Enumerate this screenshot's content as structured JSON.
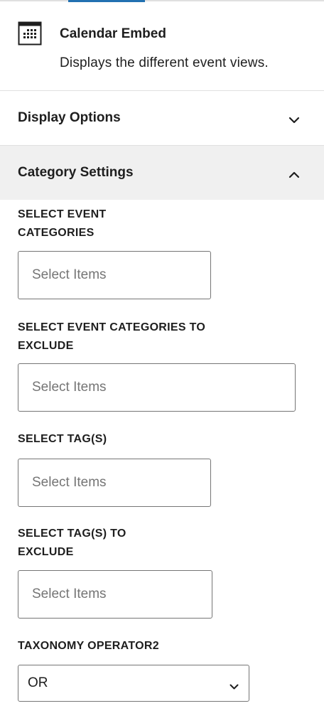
{
  "block": {
    "icon": "calendar-icon",
    "title": "Calendar Embed",
    "description": "Displays the different event views."
  },
  "panels": {
    "display_options": {
      "title": "Display Options",
      "state": "collapsed",
      "icon": "chevron-down-icon"
    },
    "category_settings": {
      "title": "Category Settings",
      "state": "expanded",
      "icon": "chevron-up-icon"
    }
  },
  "fields": {
    "event_categories": {
      "label_line1": "SELECT EVENT",
      "label_line2": "CATEGORIES",
      "placeholder": "Select Items",
      "value": ""
    },
    "exclude_categories": {
      "label_line1": "SELECT EVENT CATEGORIES TO",
      "label_line2": "EXCLUDE",
      "placeholder": "Select Items",
      "value": ""
    },
    "tags": {
      "label_line1": "SELECT TAG(S)",
      "placeholder": "Select Items",
      "value": ""
    },
    "exclude_tags": {
      "label_line1": "SELECT TAG(S) TO",
      "label_line2": "EXCLUDE",
      "placeholder": "Select Items",
      "value": ""
    },
    "taxonomy_operator": {
      "label": "TAXONOMY OPERATOR2",
      "selected": "OR",
      "icon": "chevron-down-icon"
    }
  },
  "colors": {
    "accent": "#2271b1",
    "panel_open_bg": "#f0f0f0",
    "border": "#757575",
    "divider": "#e0e0e0",
    "placeholder": "#757575",
    "text": "#1e1e1e"
  }
}
